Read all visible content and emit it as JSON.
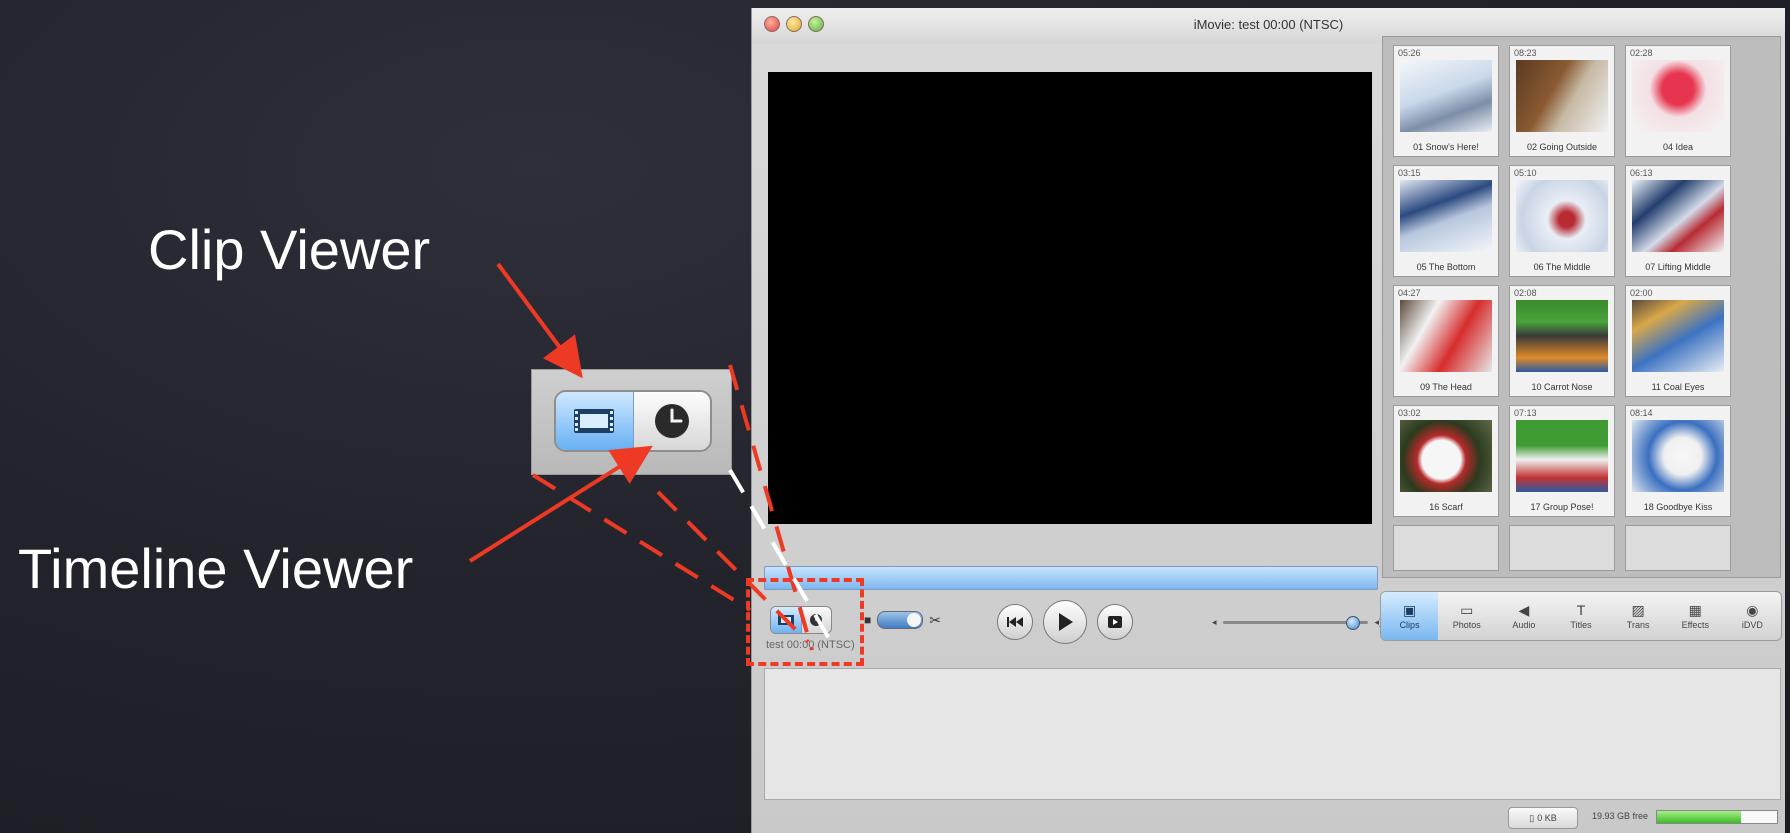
{
  "callouts": {
    "clip_viewer": "Clip Viewer",
    "timeline_viewer": "Timeline Viewer"
  },
  "window": {
    "title": "iMovie: test  00:00 (NTSC)"
  },
  "clips": [
    {
      "dur": "05:26",
      "name": "01 Snow's Here!"
    },
    {
      "dur": "08:23",
      "name": "02 Going Outside"
    },
    {
      "dur": "02:28",
      "name": "04 Idea"
    },
    {
      "dur": "03:15",
      "name": "05 The Bottom"
    },
    {
      "dur": "05:10",
      "name": "06 The Middle"
    },
    {
      "dur": "06:13",
      "name": "07 Lifting Middle"
    },
    {
      "dur": "04:27",
      "name": "09 The Head"
    },
    {
      "dur": "02:08",
      "name": "10 Carrot Nose"
    },
    {
      "dur": "02:00",
      "name": "11 Coal Eyes"
    },
    {
      "dur": "03:02",
      "name": "16 Scarf"
    },
    {
      "dur": "07:13",
      "name": "17 Group Pose!"
    },
    {
      "dur": "08:14",
      "name": "18 Goodbye Kiss"
    }
  ],
  "controls": {
    "timecode": "test  00:00 (NTSC)"
  },
  "tools": [
    {
      "label": "Clips",
      "icon": "clips-icon"
    },
    {
      "label": "Photos",
      "icon": "photos-icon"
    },
    {
      "label": "Audio",
      "icon": "audio-icon"
    },
    {
      "label": "Titles",
      "icon": "titles-icon"
    },
    {
      "label": "Trans",
      "icon": "trans-icon"
    },
    {
      "label": "Effects",
      "icon": "effects-icon"
    },
    {
      "label": "iDVD",
      "icon": "idvd-icon"
    }
  ],
  "status": {
    "trash": "0 KB",
    "free_space": "19.93 GB free",
    "free_fraction": 0.7
  },
  "colors": {
    "accent_red": "#ee3a24",
    "selection_blue": "#6fb3f1"
  }
}
